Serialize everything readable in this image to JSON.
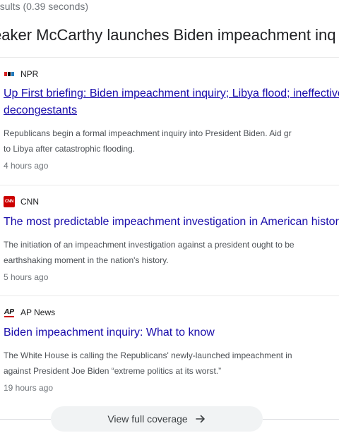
{
  "results_stats": "esults (0.39 seconds)",
  "cluster_title": "eaker McCarthy launches Biden impeachment inq",
  "articles": [
    {
      "source": "NPR",
      "favicon": "npr-logo-icon",
      "headline_line1": "Up First briefing: Biden impeachment inquiry; Libya flood; ineffective",
      "headline_line2": "decongestants",
      "snippet_line1": "Republicans begin a formal impeachment inquiry into President Biden. Aid gr",
      "snippet_line2": "to Libya after catastrophic flooding.",
      "time": "4 hours ago"
    },
    {
      "source": "CNN",
      "favicon": "cnn-logo-icon",
      "favicon_text": "CNN",
      "headline_line1": "The most predictable impeachment investigation in American histor",
      "snippet_line1": "The initiation of an impeachment investigation against a president ought to be",
      "snippet_line2": "earthshaking moment in the nation's history.",
      "time": "5 hours ago"
    },
    {
      "source": "AP News",
      "favicon": "ap-logo-icon",
      "favicon_text": "AP",
      "headline_line1": "Biden impeachment inquiry: What to know",
      "snippet_line1": "The White House is calling the Republicans' newly-launched impeachment in",
      "snippet_line2": "against President Joe Biden “extreme politics at its worst.”",
      "time": "19 hours ago"
    }
  ],
  "coverage_button": {
    "label": "View full coverage",
    "icon": "arrow-right-icon"
  },
  "colors": {
    "link": "#1a0dab",
    "snippet": "#4d5156",
    "meta": "#70757a",
    "cnn_red": "#cc0000"
  }
}
